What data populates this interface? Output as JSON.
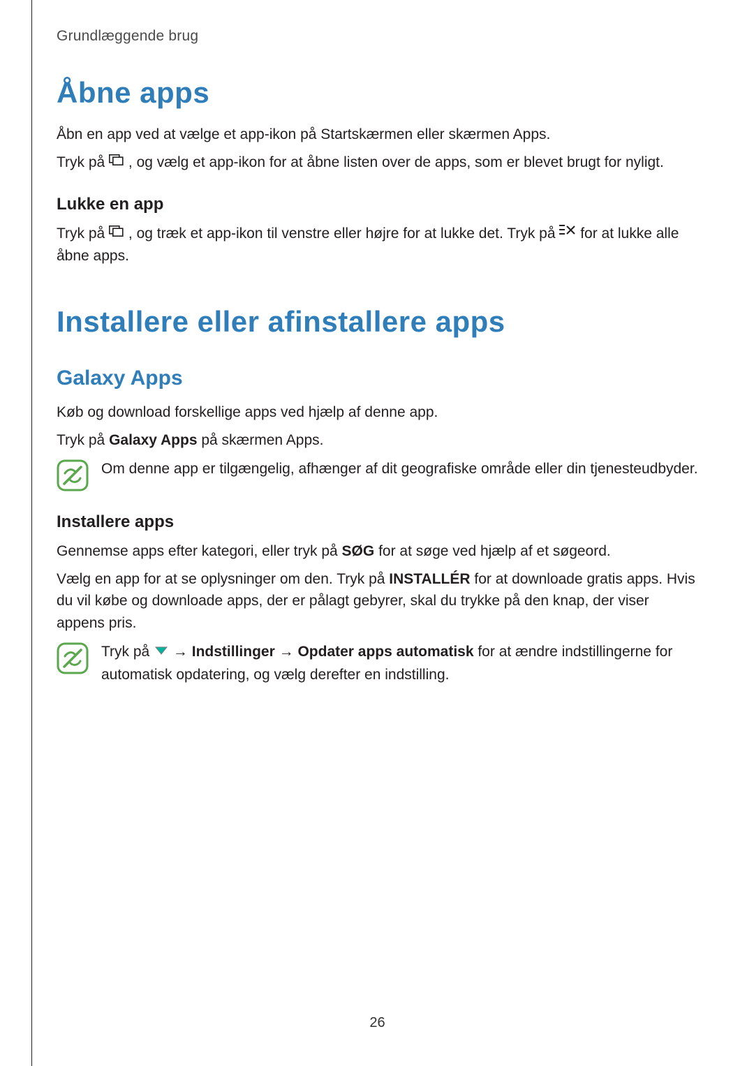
{
  "breadcrumb": "Grundlæggende brug",
  "section1": {
    "title": "Åbne apps",
    "p1": "Åbn en app ved at vælge et app-ikon på Startskærmen eller skærmen Apps.",
    "p2_a": "Tryk på ",
    "p2_b": ", og vælg et app-ikon for at åbne listen over de apps, som er blevet brugt for nyligt.",
    "sub1_head": "Lukke en app",
    "sub1_p_a": "Tryk på ",
    "sub1_p_b": ", og træk et app-ikon til venstre eller højre for at lukke det. Tryk på ",
    "sub1_p_c": " for at lukke alle åbne apps."
  },
  "section2": {
    "title": "Installere eller afinstallere apps",
    "sub1_title": "Galaxy Apps",
    "sub1_p1": "Køb og download forskellige apps ved hjælp af denne app.",
    "sub1_p2_a": "Tryk på ",
    "sub1_p2_bold": "Galaxy Apps",
    "sub1_p2_b": " på skærmen Apps.",
    "note1": "Om denne app er tilgængelig, afhænger af dit geografiske område eller din tjenesteudbyder.",
    "sub2_head": "Installere apps",
    "sub2_p1_a": "Gennemse apps efter kategori, eller tryk på ",
    "sub2_p1_bold": "SØG",
    "sub2_p1_b": " for at søge ved hjælp af et søgeord.",
    "sub2_p2_a": "Vælg en app for at se oplysninger om den. Tryk på ",
    "sub2_p2_bold": "INSTALLÉR",
    "sub2_p2_b": " for at downloade gratis apps. Hvis du vil købe og downloade apps, der er pålagt gebyrer, skal du trykke på den knap, der viser appens pris.",
    "note2_a": "Tryk på ",
    "note2_arrow1": " → ",
    "note2_bold1": "Indstillinger",
    "note2_arrow2": " → ",
    "note2_bold2": "Opdater apps automatisk",
    "note2_b": " for at ændre indstillingerne for automatisk opdatering, og vælg derefter en indstilling."
  },
  "page_number": "26"
}
